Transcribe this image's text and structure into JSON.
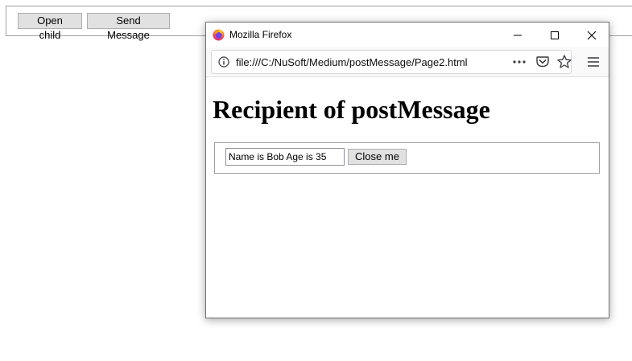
{
  "parent": {
    "open_child_label": "Open child",
    "send_message_label": "Send Message"
  },
  "popup": {
    "window_title": "Mozilla Firefox",
    "url": "file:///C:/NuSoft/Medium/postMessage/Page2.html",
    "icons": {
      "logo": "firefox-logo-icon",
      "minimize": "minimize-icon",
      "maximize": "maximize-icon",
      "close": "close-icon",
      "info": "info-icon",
      "more": "more-actions-icon",
      "pocket": "pocket-icon",
      "bookmark": "star-icon",
      "menu": "hamburger-menu-icon"
    },
    "page": {
      "heading": "Recipient of postMessage",
      "message_value": "Name is Bob Age is  35",
      "close_me_label": "Close me"
    }
  },
  "colors": {
    "button_bg": "#e1e1e1",
    "border": "#a0a0a0",
    "firefox_orange": "#ff7139",
    "firefox_purple": "#7542e5"
  }
}
